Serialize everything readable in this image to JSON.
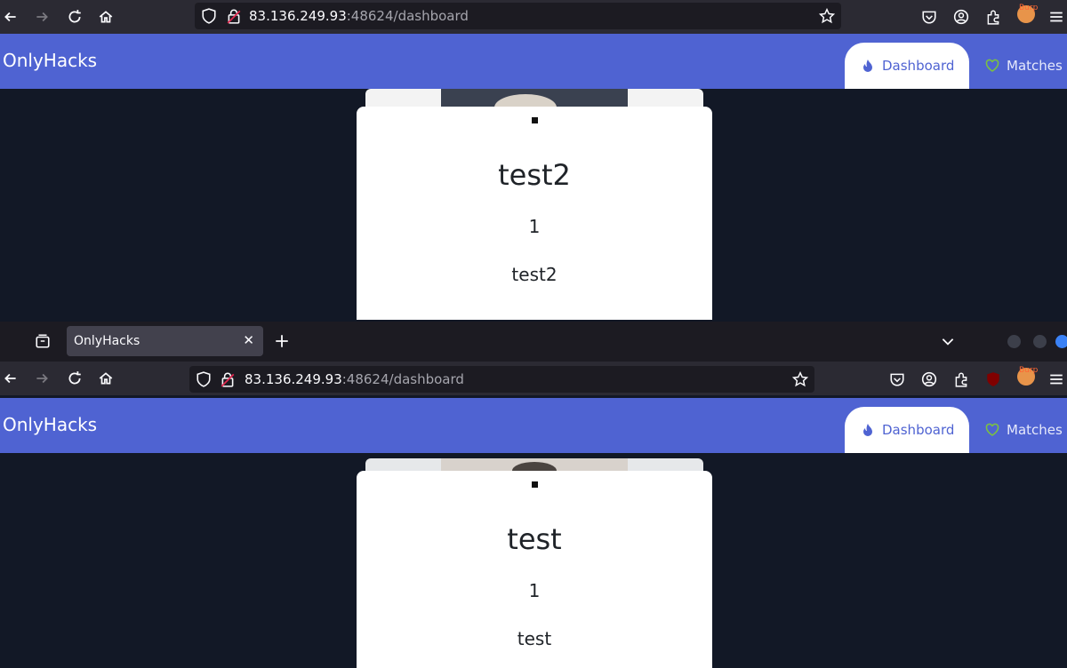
{
  "top_window": {
    "url": {
      "host": "83.136.249.93",
      "path": ":48624/dashboard"
    },
    "app": {
      "brand": "OnlyHacks",
      "tabs": [
        {
          "label": "Dashboard"
        },
        {
          "label": "Matches"
        }
      ]
    },
    "card": {
      "name": "test2",
      "age": "1",
      "description": "test2"
    }
  },
  "bottom_window": {
    "tab": {
      "title": "OnlyHacks"
    },
    "url": {
      "host": "83.136.249.93",
      "path": ":48624/dashboard"
    },
    "app": {
      "brand": "OnlyHacks",
      "tabs": [
        {
          "label": "Dashboard"
        },
        {
          "label": "Matches"
        }
      ]
    },
    "card": {
      "name": "test",
      "age": "1",
      "description": "test"
    }
  },
  "extensions": {
    "burp_label": "Burp"
  },
  "colors": {
    "nav": "#4f63d2",
    "background": "#121826",
    "match_icon": "#7bc142"
  }
}
